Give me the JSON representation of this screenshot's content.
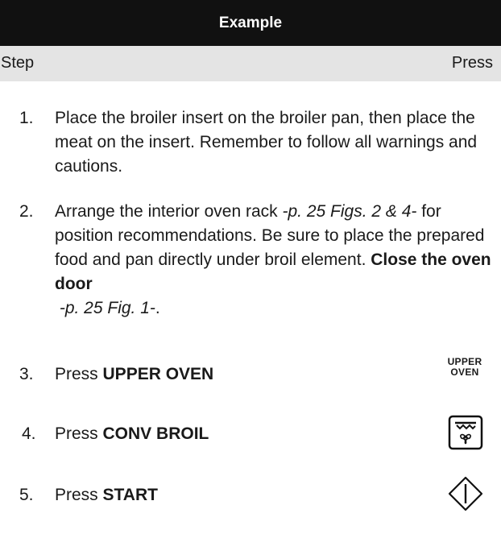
{
  "header": {
    "title": "Example"
  },
  "table_header": {
    "step": "Step",
    "press": "Press"
  },
  "steps": [
    {
      "number": "1.",
      "text": "Place the broiler insert on the broiler pan, then place the meat on the insert. Remember to follow all warnings and cautions."
    },
    {
      "number": "2.",
      "text_a": "Arrange the interior oven rack ",
      "ref1": "-p. 25 Figs. 2 & 4-",
      "text_b": " for position recommendations. Be sure to place the prepared food and pan directly under broil element. ",
      "bold": "Close the oven door",
      "ref2": "-p. 25 Fig. 1-",
      "end": "."
    },
    {
      "number": "3.",
      "prefix": "Press ",
      "key": "UPPER OVEN",
      "icon": "upper-oven-key-icon",
      "icon_text_line1": "UPPER",
      "icon_text_line2": "OVEN"
    },
    {
      "number": "4.",
      "prefix": "Press ",
      "key": "CONV BROIL",
      "icon": "conv-broil-key-icon"
    },
    {
      "number": "5.",
      "prefix": "Press ",
      "key": "START",
      "icon": "start-key-icon"
    }
  ]
}
